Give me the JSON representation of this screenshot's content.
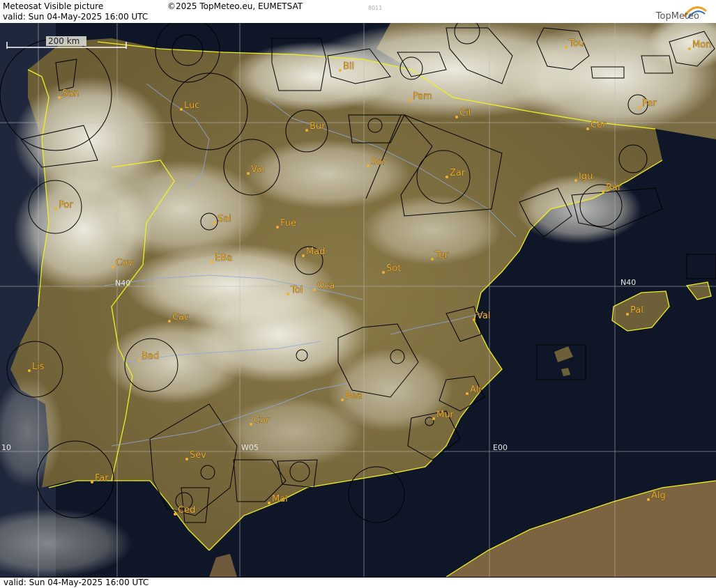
{
  "header": {
    "title": "Meteosat Visible picture",
    "copyright": "©2025 TopMeteo.eu, EUMETSAT",
    "code": "8011",
    "valid": "valid:  Sun  04-May-2025  16:00 UTC",
    "logo": "TopMeteo"
  },
  "scale": {
    "label": "200 km"
  },
  "grid_labels": {
    "n40_left": "N40",
    "n40_right": "N40",
    "w05": "W05",
    "e00": "E00",
    "w10": "10"
  },
  "cities": [
    {
      "name": "San"
    },
    {
      "name": "Luc"
    },
    {
      "name": "Bil"
    },
    {
      "name": "Pam"
    },
    {
      "name": "Cil"
    },
    {
      "name": "Tou"
    },
    {
      "name": "Mon"
    },
    {
      "name": "Per"
    },
    {
      "name": "Cer"
    },
    {
      "name": "Bur"
    },
    {
      "name": "Sor"
    },
    {
      "name": "Val"
    },
    {
      "name": "Zar"
    },
    {
      "name": "Igu"
    },
    {
      "name": "Bar"
    },
    {
      "name": "Por"
    },
    {
      "name": "Sal"
    },
    {
      "name": "Fue"
    },
    {
      "name": "Mad"
    },
    {
      "name": "EBa"
    },
    {
      "name": "Cov"
    },
    {
      "name": "Tol"
    },
    {
      "name": "Oca"
    },
    {
      "name": "Sot"
    },
    {
      "name": "Ter"
    },
    {
      "name": "Pal"
    },
    {
      "name": "Cac"
    },
    {
      "name": "Val"
    },
    {
      "name": "Bad"
    },
    {
      "name": "Lis"
    },
    {
      "name": "Ali"
    },
    {
      "name": "Bea"
    },
    {
      "name": "Mur"
    },
    {
      "name": "Cor"
    },
    {
      "name": "Sev"
    },
    {
      "name": "Far"
    },
    {
      "name": "Mal"
    },
    {
      "name": "Ced"
    },
    {
      "name": "Alg"
    }
  ],
  "footer": {
    "valid": "valid:  Sun  04-May-2025  16:00 UTC"
  },
  "colors": {
    "label": "#f0b030",
    "border": "#f0f020",
    "sea": "#0c1428"
  }
}
